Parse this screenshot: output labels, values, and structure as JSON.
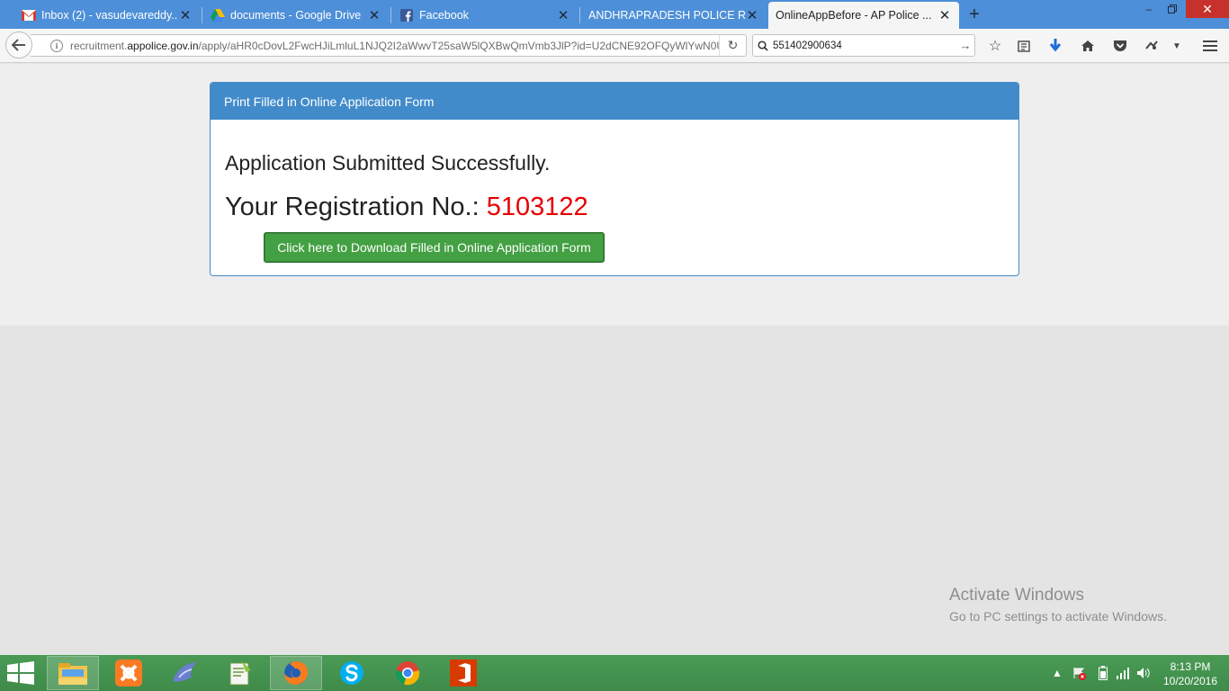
{
  "browser": {
    "tabs": [
      {
        "title": "Inbox (2) - vasudevareddy...",
        "icon": "gmail-icon"
      },
      {
        "title": "documents - Google Drive",
        "icon": "google-drive-icon"
      },
      {
        "title": "Facebook",
        "icon": "facebook-icon"
      },
      {
        "title": "ANDHRAPRADESH POLICE RE...",
        "icon": "none"
      },
      {
        "title": "OnlineAppBefore - AP Police ...",
        "icon": "none",
        "active": true
      }
    ],
    "url_prefix": "recruitment.",
    "url_domain": "appolice.gov.in",
    "url_path": "/apply/aHR0cDovL2FwcHJiLmluL1NJQ2I2aWwvT25saW5lQXBwQmVmb3JlP?id=U2dCNE92OFQyWlYwN0U",
    "search_value": "551402900634"
  },
  "panel": {
    "heading": "Print Filled in Online Application Form",
    "message": "Application Submitted Successfully.",
    "reg_label": "Your Registration No.: ",
    "reg_number": "5103122",
    "download_label": "Click here to Download Filled in Online Application Form"
  },
  "watermark": {
    "line1": "Activate Windows",
    "line2": "Go to PC settings to activate Windows."
  },
  "taskbar": {
    "time": "8:13 PM",
    "date": "10/20/2016"
  },
  "colors": {
    "panel_primary": "#428bca",
    "reg_number": "#e60000",
    "download_button": "#43a043",
    "tabstrip": "#4d8fd8",
    "taskbar": "#4a9a55"
  }
}
